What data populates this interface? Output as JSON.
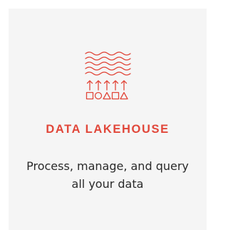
{
  "colors": {
    "accent": "#e1473a",
    "card_background": "#f5f5f5",
    "text": "#2a2a2a"
  },
  "card": {
    "icon": "data-lakehouse-icon",
    "title": "DATA LAKEHOUSE",
    "description": "Process, manage, and query all your data"
  }
}
